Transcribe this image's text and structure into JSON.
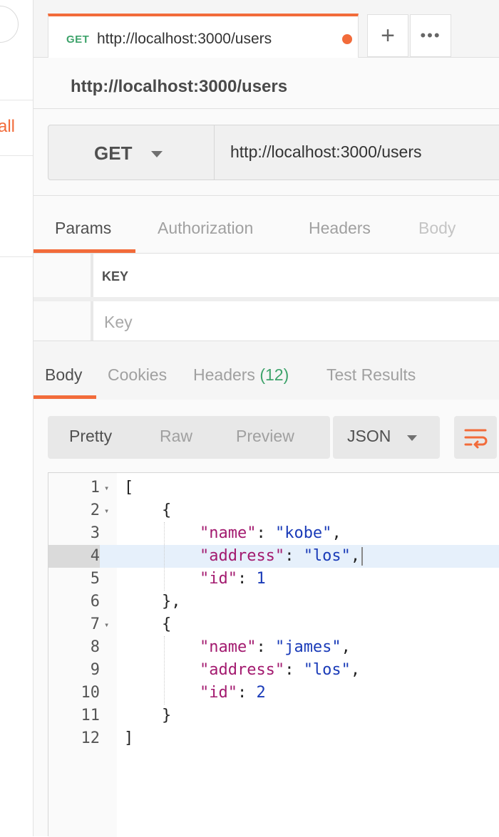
{
  "sidebar": {
    "link_label": "all"
  },
  "tabbar": {
    "tab": {
      "method": "GET",
      "url": "http://localhost:3000/users"
    },
    "add_label": "+",
    "more_label": "•••"
  },
  "request": {
    "name": "http://localhost:3000/users",
    "method": "GET",
    "url": "http://localhost:3000/users"
  },
  "request_tabs": [
    "Params",
    "Authorization",
    "Headers",
    "Body"
  ],
  "params": {
    "key_header": "KEY",
    "key_placeholder": "Key"
  },
  "response_tabs": {
    "body": "Body",
    "cookies": "Cookies",
    "headers": "Headers",
    "headers_count": "(12)",
    "tests": "Test Results"
  },
  "response_toolbar": {
    "formats": [
      "Pretty",
      "Raw",
      "Preview"
    ],
    "language": "JSON"
  },
  "colors": {
    "accent": "#f26b3a",
    "success": "#3ea36b",
    "json_key": "#a31a6f",
    "json_value": "#1a3bb8"
  },
  "editor": {
    "lines": [
      {
        "n": "1",
        "text": "["
      },
      {
        "n": "2",
        "text": "    {"
      },
      {
        "n": "3",
        "key": "\"name\"",
        "value": "\"kobe\""
      },
      {
        "n": "4",
        "key": "\"address\"",
        "value": "\"los\""
      },
      {
        "n": "5",
        "key": "\"id\"",
        "value": "1"
      },
      {
        "n": "6",
        "text": "    },"
      },
      {
        "n": "7",
        "text": "    {"
      },
      {
        "n": "8",
        "key": "\"name\"",
        "value": "\"james\""
      },
      {
        "n": "9",
        "key": "\"address\"",
        "value": "\"los\""
      },
      {
        "n": "10",
        "key": "\"id\"",
        "value": "2"
      },
      {
        "n": "11",
        "text": "    }"
      },
      {
        "n": "12",
        "text": "]"
      }
    ]
  }
}
